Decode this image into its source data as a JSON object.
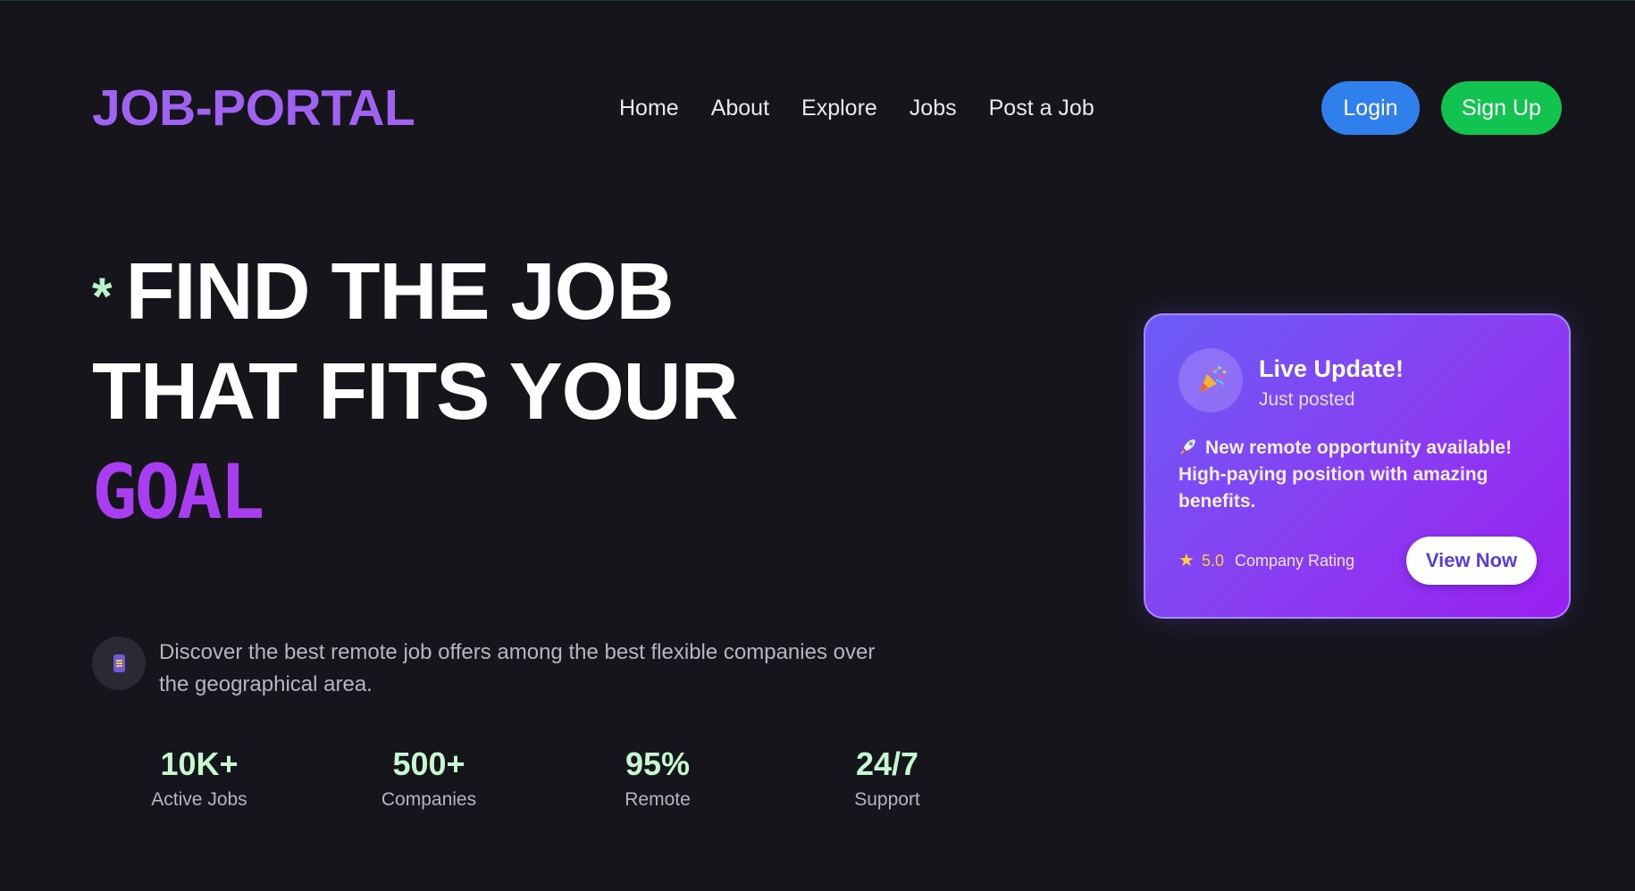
{
  "brand": {
    "logo_text": "JOB-PORTAL",
    "logo_color": "#a062f0"
  },
  "nav": {
    "links": [
      "Home",
      "About",
      "Explore",
      "Jobs",
      "Post a Job"
    ],
    "login_label": "Login",
    "signup_label": "Sign Up",
    "login_color": "#2f80ed",
    "signup_color": "#12c350"
  },
  "hero": {
    "asterisk": "*",
    "line1": "FIND THE JOB",
    "line2": "THAT FITS YOUR",
    "highlight": "GOAL",
    "highlight_color": "#a93df0",
    "description_icon": "phone-icon",
    "description": "Discover the best remote job offers among the best flexible companies over the geographical area."
  },
  "stats": [
    {
      "value": "10K+",
      "label": "Active Jobs"
    },
    {
      "value": "500+",
      "label": "Companies"
    },
    {
      "value": "95%",
      "label": "Remote"
    },
    {
      "value": "24/7",
      "label": "Support"
    }
  ],
  "live_card": {
    "icon": "party-popper-icon",
    "title": "Live Update!",
    "subtitle": "Just posted",
    "message_icon": "rocket-icon",
    "message": "New remote opportunity available! High-paying position with amazing benefits.",
    "rating_icon": "star-icon",
    "rating_value": "5.0",
    "rating_label": "Company Rating",
    "button_label": "View Now"
  },
  "colors": {
    "background": "#15151b",
    "stat_value": "#c6f7cf",
    "card_gradient_start": "#6b5cf6",
    "card_gradient_end": "#9a1ff0"
  }
}
